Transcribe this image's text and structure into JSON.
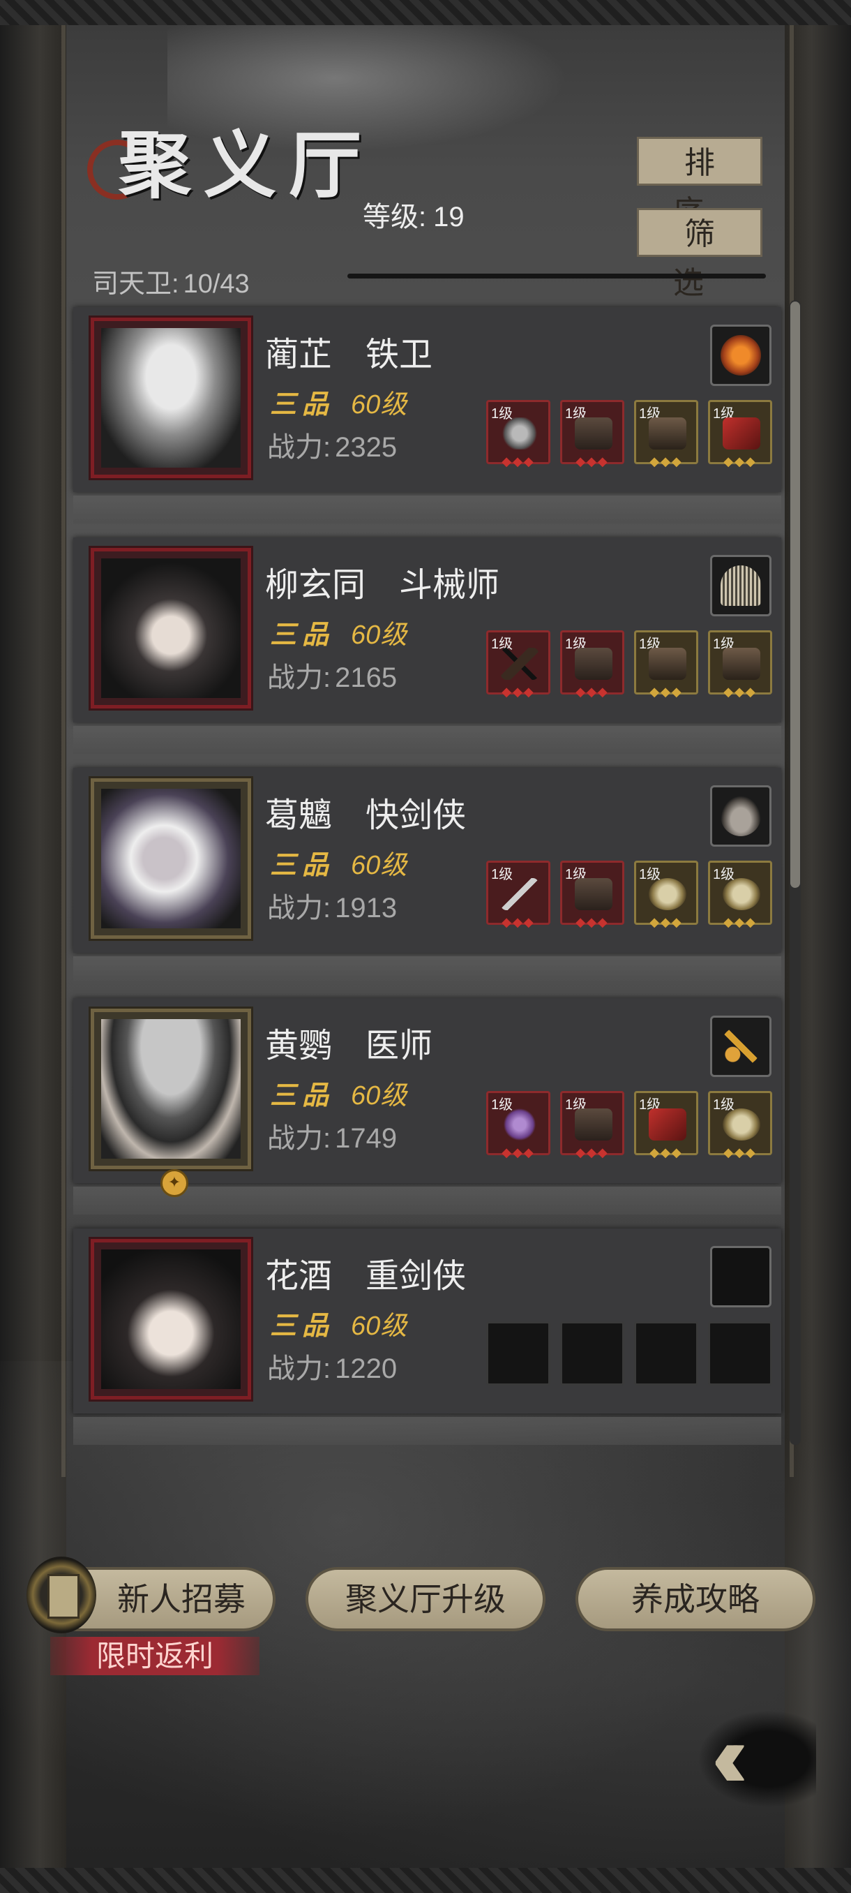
{
  "header": {
    "title": "聚义厅",
    "level_label": "等级:",
    "level_value": "19",
    "sort_label": "排序",
    "filter_label": "筛选",
    "guard_label": "司天卫:",
    "guard_value": "10/43"
  },
  "heroes": [
    {
      "name": "蔺芷　铁卫",
      "rank": "三品",
      "level": "60级",
      "power_label": "战力:",
      "power": "2325",
      "treasure": "amber-stone",
      "gear": [
        {
          "level": "1级",
          "item": "mace",
          "quality": "red"
        },
        {
          "level": "1级",
          "item": "armor",
          "quality": "red"
        },
        {
          "level": "1级",
          "item": "boots",
          "quality": "gold"
        },
        {
          "level": "1级",
          "item": "red-cloak",
          "quality": "gold"
        }
      ]
    },
    {
      "name": "柳玄同　斗械师",
      "rank": "三品",
      "level": "60级",
      "power_label": "战力:",
      "power": "2165",
      "treasure": "comb",
      "gear": [
        {
          "level": "1级",
          "item": "crossbow",
          "quality": "red"
        },
        {
          "level": "1级",
          "item": "armor",
          "quality": "red"
        },
        {
          "level": "1级",
          "item": "boots",
          "quality": "gold"
        },
        {
          "level": "1级",
          "item": "boots",
          "quality": "gold"
        }
      ]
    },
    {
      "name": "葛魑　快剑侠",
      "rank": "三品",
      "level": "60级",
      "power_label": "战力:",
      "power": "1913",
      "treasure": "rabbit",
      "gear": [
        {
          "level": "1级",
          "item": "sword",
          "quality": "red"
        },
        {
          "level": "1级",
          "item": "armor",
          "quality": "red"
        },
        {
          "level": "1级",
          "item": "pouch",
          "quality": "gold"
        },
        {
          "level": "1级",
          "item": "pouch",
          "quality": "gold"
        }
      ]
    },
    {
      "name": "黄鹦　医师",
      "rank": "三品",
      "level": "60级",
      "power_label": "战力:",
      "power": "1749",
      "treasure": "hairpin",
      "gear": [
        {
          "level": "1级",
          "item": "gourd",
          "quality": "red"
        },
        {
          "level": "1级",
          "item": "armor",
          "quality": "red"
        },
        {
          "level": "1级",
          "item": "red-cloak",
          "quality": "gold"
        },
        {
          "level": "1级",
          "item": "pouch",
          "quality": "gold"
        }
      ]
    },
    {
      "name": "花酒　重剑侠",
      "rank": "三品",
      "level": "60级",
      "power_label": "战力:",
      "power": "1220",
      "treasure": "empty",
      "gear": [
        {
          "level": "",
          "item": "empty",
          "quality": "empty"
        },
        {
          "level": "",
          "item": "empty",
          "quality": "empty"
        },
        {
          "level": "",
          "item": "empty",
          "quality": "empty"
        },
        {
          "level": "",
          "item": "empty",
          "quality": "empty"
        }
      ]
    }
  ],
  "footer": {
    "recruit_label": "新人招募",
    "upgrade_label": "聚义厅升级",
    "guide_label": "养成攻略",
    "promo_label": "限时返利",
    "back_icon": "double-chevron-left-icon"
  },
  "colors": {
    "gold_text": "#e5b844",
    "red_frame": "#7e1e24",
    "gold_frame": "#6f6242",
    "button_fill": "#b7ab92"
  }
}
